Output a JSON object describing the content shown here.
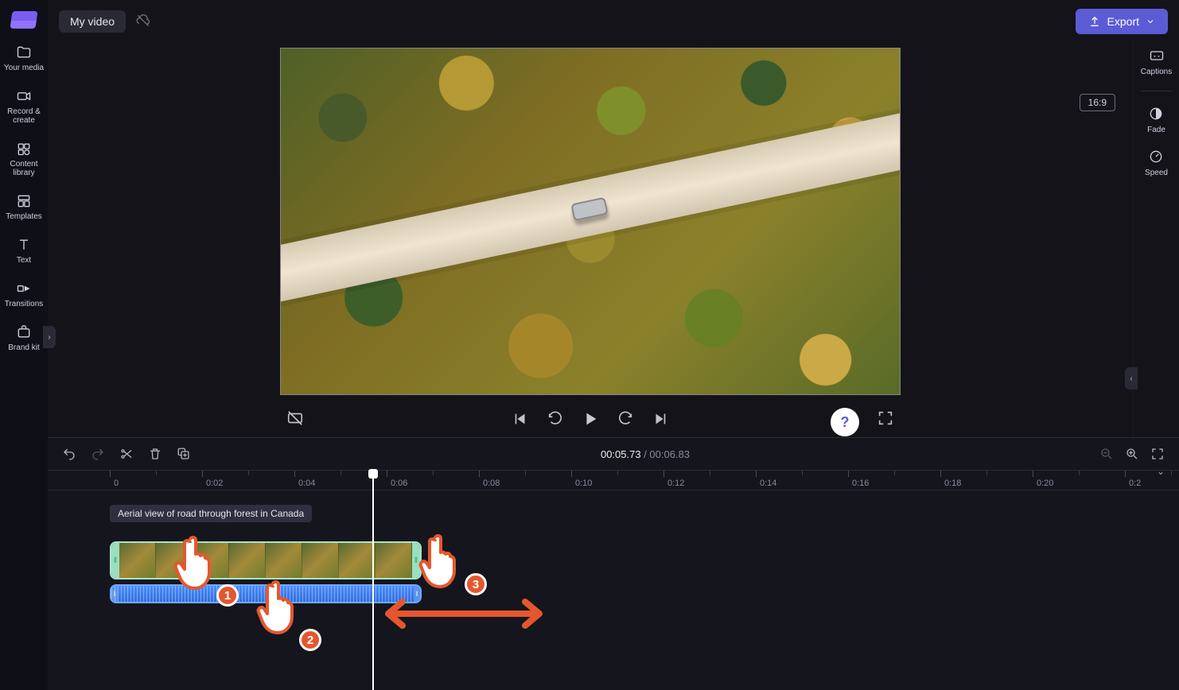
{
  "header": {
    "title": "My video",
    "export_label": "Export"
  },
  "leftRail": {
    "items": [
      {
        "label": "Your media",
        "icon": "folder"
      },
      {
        "label": "Record & create",
        "icon": "camera"
      },
      {
        "label": "Content library",
        "icon": "library"
      },
      {
        "label": "Templates",
        "icon": "templates"
      },
      {
        "label": "Text",
        "icon": "text"
      },
      {
        "label": "Transitions",
        "icon": "transitions"
      },
      {
        "label": "Brand kit",
        "icon": "brandkit"
      }
    ]
  },
  "rightRail": {
    "aspect": "16:9",
    "items": [
      {
        "label": "Captions",
        "icon": "captions"
      },
      {
        "label": "Fade",
        "icon": "fade"
      },
      {
        "label": "Speed",
        "icon": "speed"
      }
    ]
  },
  "transport": {
    "current_time": "00:05.73",
    "duration": "00:06.83",
    "separator": " / "
  },
  "timeline": {
    "ticks": [
      "0",
      "0:02",
      "0:04",
      "0:06",
      "0:08",
      "0:10",
      "0:12",
      "0:14",
      "0:16",
      "0:18",
      "0:20",
      "0:2"
    ],
    "clip_tooltip": "Aerial view of road through forest in Canada"
  },
  "tutorial": {
    "badges": [
      "1",
      "2",
      "3"
    ]
  },
  "help": "?"
}
